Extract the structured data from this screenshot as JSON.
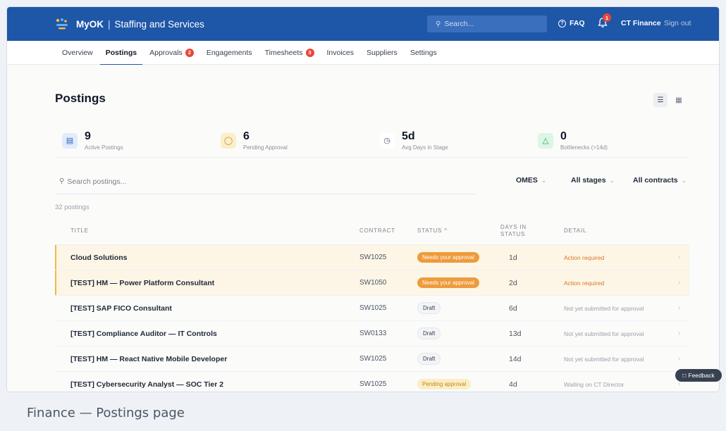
{
  "header": {
    "brand_name": "MyOK",
    "brand_separator": "|",
    "brand_sub": "Staffing and Services",
    "search_placeholder": "Search...",
    "faq_label": "FAQ",
    "notification_count": "1",
    "org_name": "CT Finance",
    "signout_label": "Sign out"
  },
  "nav": {
    "items": [
      {
        "label": "Overview"
      },
      {
        "label": "Postings",
        "active": true
      },
      {
        "label": "Approvals",
        "badge": "2"
      },
      {
        "label": "Engagements"
      },
      {
        "label": "Timesheets",
        "badge": "3"
      },
      {
        "label": "Invoices"
      },
      {
        "label": "Suppliers"
      },
      {
        "label": "Settings"
      }
    ]
  },
  "page": {
    "title": "Postings",
    "count_text": "32 postings"
  },
  "stats": [
    {
      "value": "9",
      "label": "Active Postings",
      "icon": "document-icon",
      "color": "#e2ebfb"
    },
    {
      "value": "6",
      "label": "Pending Approval",
      "icon": "shield-icon",
      "color": "#fbefc9"
    },
    {
      "value": "5d",
      "label": "Avg Days in Stage",
      "icon": "clock-icon",
      "color": "#ffffff"
    },
    {
      "value": "0",
      "label": "Bottlenecks (>14d)",
      "icon": "warning-icon",
      "color": "#dcf5e4"
    }
  ],
  "filters": {
    "search_placeholder": "Search postings...",
    "omes": "OMES",
    "stages": "All stages",
    "contracts": "All contracts"
  },
  "table": {
    "headers": {
      "title": "TITLE",
      "contract": "CONTRACT",
      "status": "STATUS",
      "status_sort": "^",
      "days_line1": "DAYS IN",
      "days_line2": "STATUS",
      "detail": "DETAIL"
    },
    "rows": [
      {
        "title": "Cloud Solutions",
        "contract": "SW1025",
        "status": "Needs your approval",
        "status_type": "needs",
        "days": "1d",
        "detail": "Action required",
        "highlight": true
      },
      {
        "title": "[TEST] HM — Power Platform Consultant",
        "contract": "SW1050",
        "status": "Needs your approval",
        "status_type": "needs",
        "days": "2d",
        "detail": "Action required",
        "highlight": true
      },
      {
        "title": "[TEST] SAP FICO Consultant",
        "contract": "SW1025",
        "status": "Draft",
        "status_type": "draft",
        "days": "6d",
        "detail": "Not yet submitted for approval",
        "highlight": false
      },
      {
        "title": "[TEST] Compliance Auditor — IT Controls",
        "contract": "SW0133",
        "status": "Draft",
        "status_type": "draft",
        "days": "13d",
        "detail": "Not yet submitted for approval",
        "highlight": false
      },
      {
        "title": "[TEST] HM — React Native Mobile Developer",
        "contract": "SW1025",
        "status": "Draft",
        "status_type": "draft",
        "days": "14d",
        "detail": "Not yet submitted for approval",
        "highlight": false
      },
      {
        "title": "[TEST] Cybersecurity Analyst — SOC Tier 2",
        "contract": "SW1025",
        "status": "Pending approval",
        "status_type": "pending",
        "days": "4d",
        "detail": "Waiting on CT Director",
        "highlight": false
      }
    ]
  },
  "feedback_label": "Feedback",
  "caption": "Finance — Postings page"
}
